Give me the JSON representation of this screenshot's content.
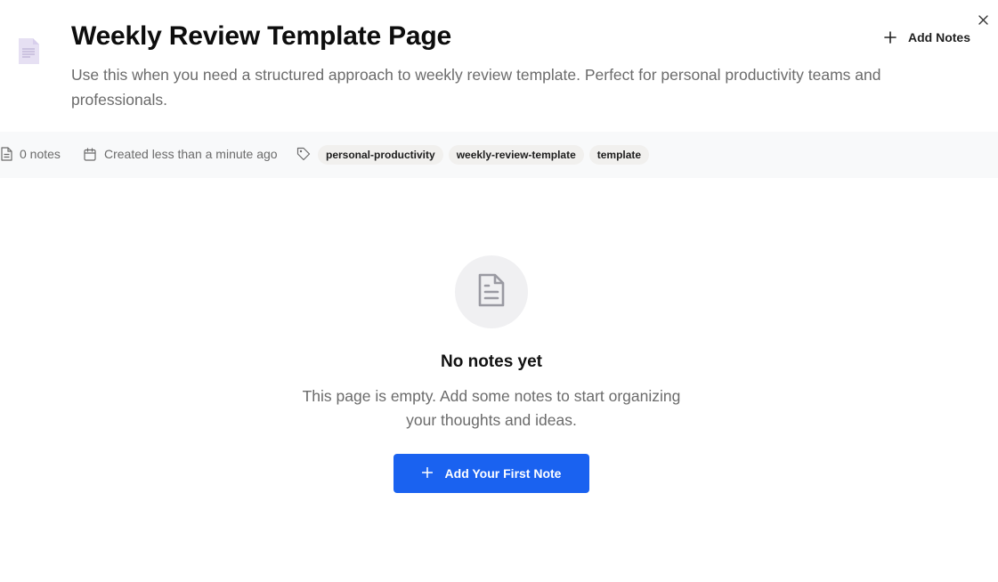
{
  "page": {
    "title": "Weekly Review Template Page",
    "description": "Use this when you need a structured approach to weekly review template. Perfect for personal productivity teams and professionals.",
    "icon": "document-icon"
  },
  "header_actions": {
    "add_notes_label": "Add Notes",
    "add_icon": "plus-icon",
    "close_icon": "close-icon"
  },
  "meta": {
    "notes_count": "0 notes",
    "created": "Created less than a minute ago",
    "tags": [
      "personal-productivity",
      "weekly-review-template",
      "template"
    ]
  },
  "empty_state": {
    "icon": "file-text-icon",
    "title": "No notes yet",
    "description": "This page is empty. Add some notes to start organizing your thoughts and ideas.",
    "button_label": "Add Your First Note"
  },
  "colors": {
    "primary": "#1a62f0",
    "page_icon": "#e6e0f3",
    "meta_bar": "#f8f9fa",
    "tag_bg": "#f1f0ee"
  }
}
